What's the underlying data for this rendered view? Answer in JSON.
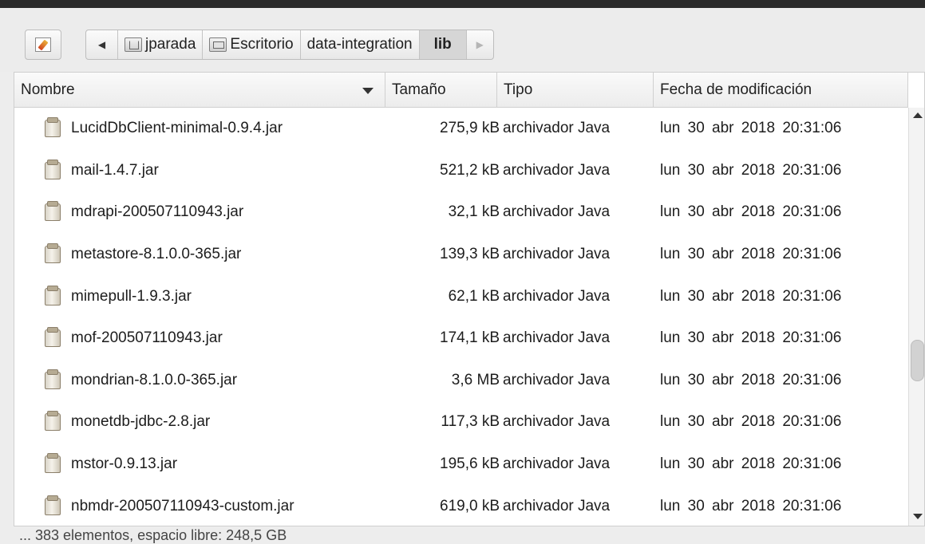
{
  "breadcrumb": {
    "items": [
      {
        "label": "jparada",
        "icon": "home-folder-icon"
      },
      {
        "label": "Escritorio",
        "icon": "desktop-folder-icon"
      },
      {
        "label": "data-integration"
      },
      {
        "label": "lib"
      }
    ]
  },
  "columns": {
    "name": "Nombre",
    "size": "Tamaño",
    "type": "Tipo",
    "modified": "Fecha de modificación"
  },
  "files": [
    {
      "name": "LucidDbClient-minimal-0.9.4.jar",
      "size": "275,9 kB",
      "type": "archivador Java",
      "modified": "lun 30 abr 2018 20:31:06"
    },
    {
      "name": "mail-1.4.7.jar",
      "size": "521,2 kB",
      "type": "archivador Java",
      "modified": "lun 30 abr 2018 20:31:06"
    },
    {
      "name": "mdrapi-200507110943.jar",
      "size": "32,1 kB",
      "type": "archivador Java",
      "modified": "lun 30 abr 2018 20:31:06"
    },
    {
      "name": "metastore-8.1.0.0-365.jar",
      "size": "139,3 kB",
      "type": "archivador Java",
      "modified": "lun 30 abr 2018 20:31:06"
    },
    {
      "name": "mimepull-1.9.3.jar",
      "size": "62,1 kB",
      "type": "archivador Java",
      "modified": "lun 30 abr 2018 20:31:06"
    },
    {
      "name": "mof-200507110943.jar",
      "size": "174,1 kB",
      "type": "archivador Java",
      "modified": "lun 30 abr 2018 20:31:06"
    },
    {
      "name": "mondrian-8.1.0.0-365.jar",
      "size": "3,6 MB",
      "type": "archivador Java",
      "modified": "lun 30 abr 2018 20:31:06"
    },
    {
      "name": "monetdb-jdbc-2.8.jar",
      "size": "117,3 kB",
      "type": "archivador Java",
      "modified": "lun 30 abr 2018 20:31:06"
    },
    {
      "name": "mstor-0.9.13.jar",
      "size": "195,6 kB",
      "type": "archivador Java",
      "modified": "lun 30 abr 2018 20:31:06"
    },
    {
      "name": "nbmdr-200507110943-custom.jar",
      "size": "619,0 kB",
      "type": "archivador Java",
      "modified": "lun 30 abr 2018 20:31:06"
    }
  ],
  "status": "... 383 elementos, espacio libre: 248,5 GB",
  "colors": {
    "accent": "#d6d6d6",
    "window_bg": "#ededed",
    "list_bg": "#ffffff"
  }
}
